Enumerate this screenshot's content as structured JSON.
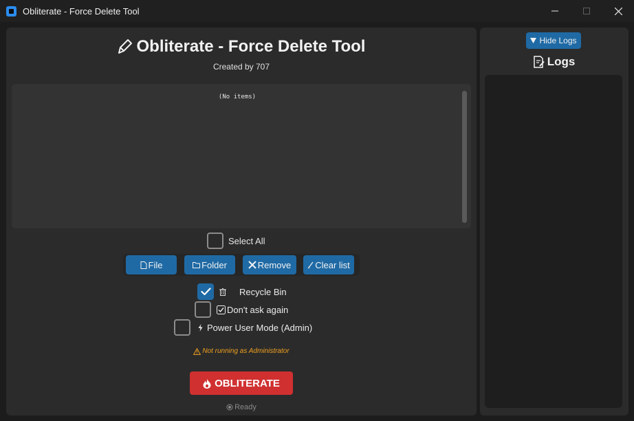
{
  "window": {
    "title": "Obliterate - Force Delete Tool",
    "controls": [
      "minimize",
      "maximize",
      "close"
    ]
  },
  "header": {
    "title": "Obliterate - Force Delete Tool",
    "subtitle": "Created by 707",
    "icon": "brush-icon"
  },
  "item_list": {
    "empty_text": "(No items)"
  },
  "select_all": {
    "label": "Select All",
    "checked": false
  },
  "buttons": {
    "file": "File",
    "folder": "Folder",
    "remove": "Remove",
    "clear_list": "Clear list"
  },
  "options": {
    "recycle_bin": {
      "label": "Recycle Bin",
      "checked": true
    },
    "dont_ask": {
      "label": "Don't ask again",
      "checked": false
    },
    "power_user": {
      "label": "Power User Mode (Admin)",
      "checked": false
    }
  },
  "warning": "Not running as Administrator",
  "obliterate_label": "OBLITERATE",
  "status": "Ready",
  "logs": {
    "toggle_label": "Hide Logs",
    "title": "Logs"
  },
  "colors": {
    "accent": "#1f6aa5",
    "danger": "#d03030",
    "warning": "#f0a020"
  }
}
